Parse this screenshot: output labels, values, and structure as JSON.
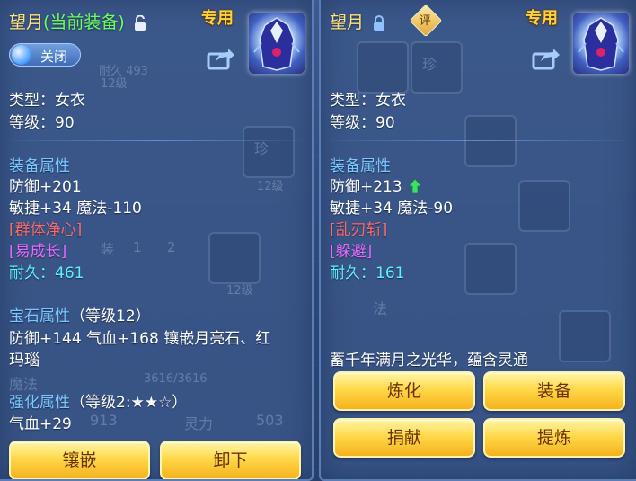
{
  "left_panel": {
    "name": "望月",
    "equipped_tag": "(当前装备)",
    "special_badge": "专用",
    "toggle_label": "关闭",
    "type_line": "类型：女衣",
    "level_line": "等级：90",
    "equip_attr_title": "装备属性",
    "stat_defense": "防御+201",
    "stat_agility_magic": "敏捷+34 魔法-110",
    "skill_1": "[群体净心]",
    "skill_2": "[易成长]",
    "durability_label": "耐久：",
    "durability_value": "461",
    "gem_attr_title": "宝石属性",
    "gem_level": "（等级12）",
    "gem_stats": "防御+144 气血+168 镶嵌月亮石、红",
    "gem_stats_2": "玛瑙",
    "enhance_title": "强化属性",
    "enhance_level": "（等级2:★★☆）",
    "enhance_stat": "气血+29",
    "buttons": {
      "inlay": "镶嵌",
      "unequip": "卸下"
    },
    "ghost": {
      "g1": "耐久 493",
      "g2": "12级",
      "g3": "珍",
      "g4": "12级",
      "g5": "12级",
      "g6": "3616/3616",
      "g7": "魔法",
      "g8": "灵力",
      "g9": "503",
      "g10": "913",
      "g11": "1",
      "g12": "2",
      "g13": "装"
    }
  },
  "right_panel": {
    "name": "望月",
    "rating_badge": "评",
    "special_badge": "专用",
    "type_line": "类型：女衣",
    "level_line": "等级：90",
    "equip_attr_title": "装备属性",
    "stat_defense": "防御+213",
    "stat_agility_magic": "敏捷+34 魔法-90",
    "skill_1": "[乱刃斩]",
    "skill_2": "[躲避]",
    "durability_label": "耐久：",
    "durability_value": "161",
    "description": "蓄千年满月之光华，蕴含灵通",
    "buttons": {
      "refine": "炼化",
      "equip": "装备",
      "donate": "捐献",
      "extract": "提炼"
    },
    "ghost": {
      "g1": "珍",
      "g2": "法"
    }
  },
  "colors": {
    "title_gold": "#ffe27a",
    "equipped_green": "#6cff5c",
    "section_blue": "#79c7ff",
    "skill_red": "#ff6a6a",
    "skill_purple": "#e56cff",
    "durability_cyan": "#5ff0ff",
    "button_gold": "#ffd84a"
  }
}
